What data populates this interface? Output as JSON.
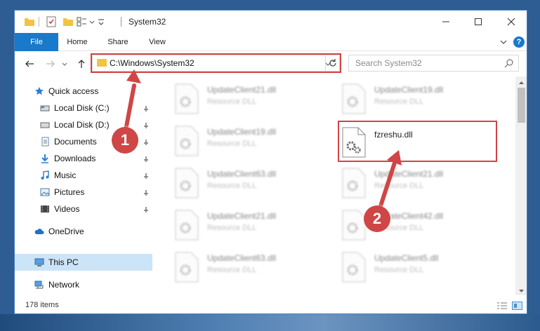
{
  "window": {
    "title": "System32"
  },
  "ribbon": {
    "tabs": [
      "File",
      "Home",
      "Share",
      "View"
    ],
    "help_label": "?"
  },
  "address": {
    "path": "C:\\Windows\\System32"
  },
  "search": {
    "placeholder": "Search System32"
  },
  "sidebar": {
    "quick_access": "Quick access",
    "items": [
      {
        "label": "Local Disk (C:)",
        "icon": "drive-icon"
      },
      {
        "label": "Local Disk (D:)",
        "icon": "drive-icon"
      },
      {
        "label": "Documents",
        "icon": "documents-icon"
      },
      {
        "label": "Downloads",
        "icon": "downloads-icon"
      },
      {
        "label": "Music",
        "icon": "music-icon"
      },
      {
        "label": "Pictures",
        "icon": "pictures-icon"
      },
      {
        "label": "Videos",
        "icon": "videos-icon"
      }
    ],
    "onedrive": "OneDrive",
    "this_pc": "This PC",
    "network": "Network"
  },
  "files": {
    "left": [
      {
        "name": "UpdateClient21.dll",
        "desc": "Resource DLL"
      },
      {
        "name": "UpdateClient19.dll",
        "desc": "Resource DLL"
      },
      {
        "name": "UpdateClient63.dll",
        "desc": "Resource DLL"
      },
      {
        "name": "UpdateClient21.dll",
        "desc": "Resource DLL"
      },
      {
        "name": "UpdateClient63.dll",
        "desc": "Resource DLL"
      }
    ],
    "right": [
      {
        "name": "UpdateClient19.dll",
        "desc": "Resource DLL"
      },
      {
        "name": "UpdateClient21.dll",
        "desc": "Resource DLL"
      },
      {
        "name": "UpdateClient42.dll",
        "desc": "Resource DLL"
      },
      {
        "name": "UpdateClient5.dll",
        "desc": "Resource DLL"
      }
    ],
    "highlighted": {
      "name": "fzreshu.dll"
    }
  },
  "status": {
    "item_count": "178 items"
  },
  "annotations": {
    "badge1": "1",
    "badge2": "2",
    "color": "#cf4646"
  }
}
